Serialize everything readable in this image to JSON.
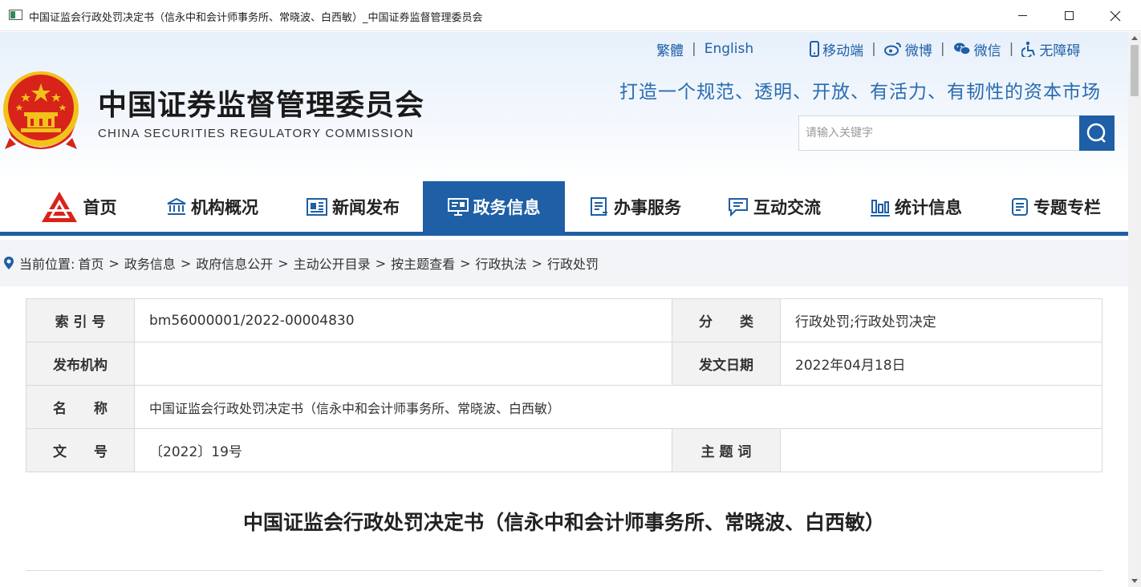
{
  "window": {
    "title": "中国证监会行政处罚决定书（信永中和会计师事务所、常晓波、白西敏）_中国证券监督管理委员会"
  },
  "header": {
    "site_title_cn": "中国证券监督管理委员会",
    "site_title_en": "CHINA SECURITIES REGULATORY COMMISSION",
    "slogan": "打造一个规范、透明、开放、有活力、有韧性的资本市场",
    "toplinks": {
      "traditional": "繁體",
      "english": "English",
      "mobile": "移动端",
      "weibo": "微博",
      "wechat": "微信",
      "accessibility": "无障碍"
    },
    "search": {
      "placeholder": "请输入关键字"
    }
  },
  "nav": {
    "items": [
      {
        "label": "首页",
        "icon": "csrc-logo-icon"
      },
      {
        "label": "机构概况",
        "icon": "bank-icon"
      },
      {
        "label": "新闻发布",
        "icon": "newspaper-icon"
      },
      {
        "label": "政务信息",
        "icon": "presentation-icon",
        "active": true
      },
      {
        "label": "办事服务",
        "icon": "document-list-icon"
      },
      {
        "label": "互动交流",
        "icon": "chat-icon"
      },
      {
        "label": "统计信息",
        "icon": "bar-chart-icon"
      },
      {
        "label": "专题专栏",
        "icon": "notes-icon"
      }
    ]
  },
  "breadcrumb": {
    "prefix": "当前位置:",
    "items": [
      "首页",
      "政务信息",
      "政府信息公开",
      "主动公开目录",
      "按主题查看",
      "行政执法",
      "行政处罚"
    ]
  },
  "info": {
    "index_label": "索 引 号",
    "index_value": "bm56000001/2022-00004830",
    "category_label": "分　　类",
    "category_value": "行政处罚;行政处罚决定",
    "publisher_label": "发布机构",
    "publisher_value": "",
    "date_label": "发文日期",
    "date_value": "2022年04月18日",
    "name_label": "名　　称",
    "name_value": "中国证监会行政处罚决定书（信永中和会计师事务所、常晓波、白西敏）",
    "docno_label": "文　　号",
    "docno_value": "〔2022〕19号",
    "keywords_label": "主 题 词",
    "keywords_value": ""
  },
  "document": {
    "title": "中国证监会行政处罚决定书（信永中和会计师事务所、常晓波、白西敏）"
  },
  "colors": {
    "primary_blue": "#1e5fa5",
    "link_blue": "#1f5fa6",
    "emblem_red": "#d8231b",
    "emblem_gold": "#f2c21b"
  }
}
